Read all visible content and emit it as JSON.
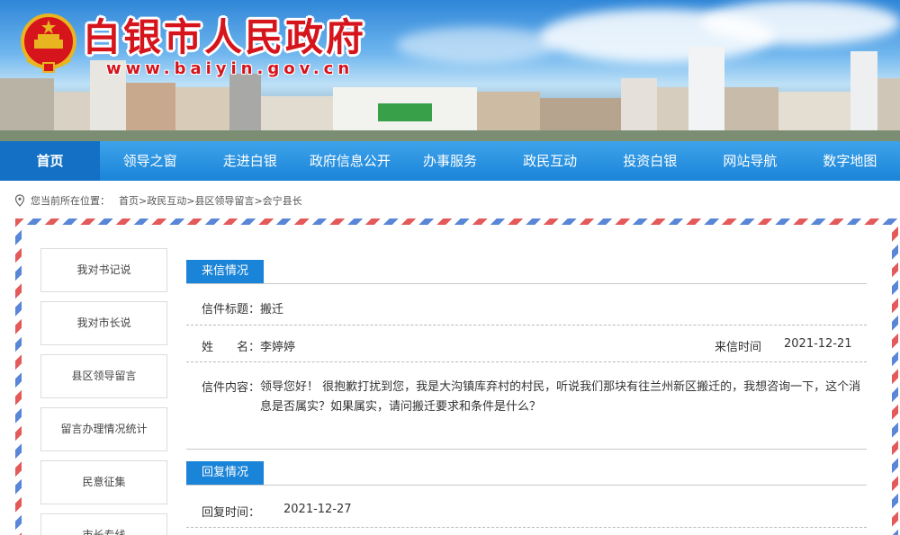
{
  "header": {
    "site_title": "白银市人民政府",
    "site_url": "www.baiyin.gov.cn"
  },
  "nav": {
    "items": [
      {
        "label": "首页",
        "active": true
      },
      {
        "label": "领导之窗"
      },
      {
        "label": "走进白银"
      },
      {
        "label": "政府信息公开"
      },
      {
        "label": "办事服务"
      },
      {
        "label": "政民互动"
      },
      {
        "label": "投资白银"
      },
      {
        "label": "网站导航"
      },
      {
        "label": "数字地图"
      }
    ]
  },
  "breadcrumb": {
    "prefix": "您当前所在位置：",
    "items": [
      "首页",
      "政民互动",
      "县区领导留言",
      "会宁县长"
    ],
    "separator": ">"
  },
  "sidebar": {
    "items": [
      {
        "label": "我对书记说"
      },
      {
        "label": "我对市长说"
      },
      {
        "label": "县区领导留言"
      },
      {
        "label": "留言办理情况统计"
      },
      {
        "label": "民意征集"
      },
      {
        "label": "市长专线"
      }
    ]
  },
  "letter": {
    "section_label": "来信情况",
    "title_label": "信件标题：",
    "title_value": "搬迁",
    "name_label": "姓　　名：",
    "name_value": "李婷婷",
    "date_label": "来信时间",
    "date_value": "2021-12-21",
    "content_label": "信件内容：",
    "content_value": "领导您好！  很抱歉打扰到您，我是大沟镇库弃村的村民，听说我们那块有往兰州新区搬迁的，我想咨询一下，这个消息是否属实？如果属实，请问搬迁要求和条件是什么？"
  },
  "reply": {
    "section_label": "回复情况",
    "time_label": "回复时间：",
    "time_value": "2021-12-27"
  },
  "colors": {
    "primary_blue": "#1a84d8",
    "title_red": "#d6141c"
  }
}
